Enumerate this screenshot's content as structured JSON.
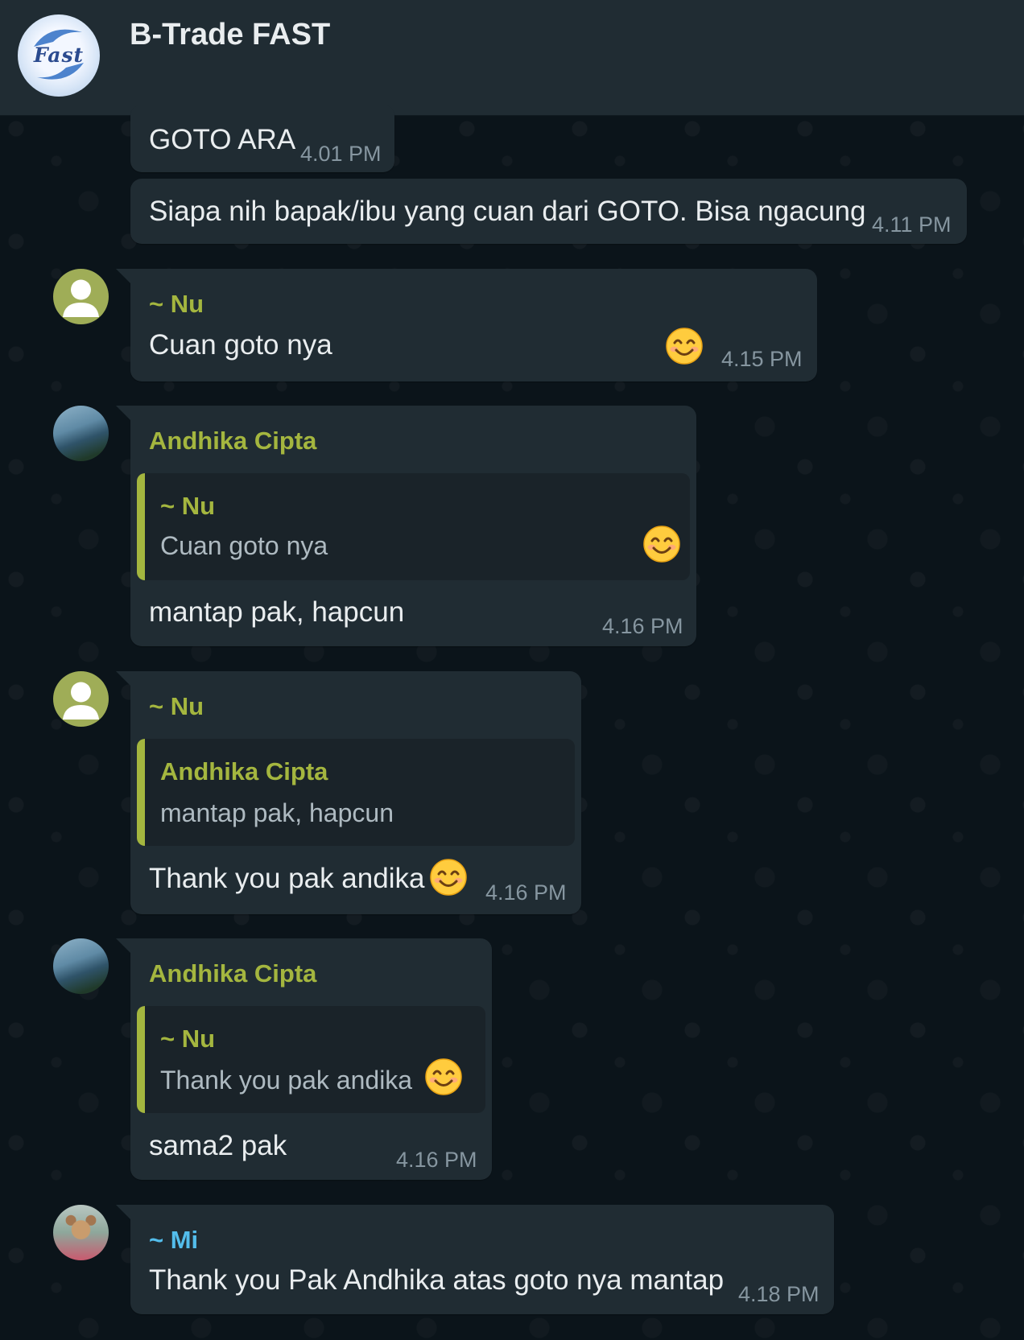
{
  "header": {
    "group_name": "B-Trade FAST",
    "logo_text": "Fast"
  },
  "messages": [
    {
      "text": "GOTO ARA",
      "time": "4.01 PM"
    },
    {
      "text": "Siapa nih bapak/ibu yang cuan dari GOTO. Bisa ngacung",
      "time": "4.11 PM"
    },
    {
      "sender": "~ Nu",
      "text": "Cuan goto nya",
      "emoji": "smiling-face",
      "time": "4.15 PM"
    },
    {
      "sender": "Andhika Cipta",
      "quote": {
        "sender": "~ Nu",
        "text": "Cuan goto nya",
        "emoji": "smiling-face"
      },
      "text": "mantap pak, hapcun",
      "time": "4.16 PM"
    },
    {
      "sender": "~ Nu",
      "quote": {
        "sender": "Andhika Cipta",
        "text": "mantap pak, hapcun"
      },
      "text": "Thank you pak andika",
      "emoji": "smiling-face",
      "time": "4.16 PM"
    },
    {
      "sender": "Andhika Cipta",
      "quote": {
        "sender": "~ Nu",
        "text": "Thank you pak andika",
        "emoji": "smiling-face"
      },
      "text": "sama2 pak",
      "time": "4.16 PM"
    },
    {
      "sender": "~ Mi",
      "text": "Thank you Pak Andhika atas goto nya mantap",
      "time": "4.18 PM"
    }
  ],
  "colors": {
    "background": "#0b141a",
    "header": "#202c33",
    "bubble": "#202c33",
    "quote": "#1a2329",
    "sender_green": "#a4b63f",
    "sender_blue": "#53bdeb",
    "timestamp": "#8696a0"
  }
}
